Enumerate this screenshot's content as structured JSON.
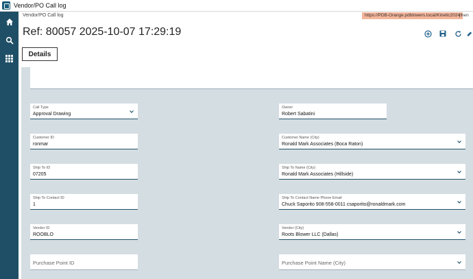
{
  "window": {
    "title": "Vendor/PO Call log"
  },
  "rail": {
    "items": [
      {
        "icon": "home-icon"
      },
      {
        "icon": "search-icon"
      },
      {
        "icon": "apps-grid-icon"
      }
    ]
  },
  "header": {
    "breadcrumb": "Vendor/PO Call log",
    "url": "https://PDB-Orange.pdblowers.local/Kinetic2024",
    "user": "jlhen",
    "ref_title": "Ref: 80057 2025-10-07 17:29:19",
    "toolbar": [
      {
        "icon": "add-circle-icon"
      },
      {
        "icon": "save-icon"
      },
      {
        "icon": "refresh-icon"
      },
      {
        "icon": "edit-pen-icon"
      }
    ],
    "tab_details": "Details"
  },
  "form": {
    "call_type": {
      "label": "Call Type",
      "value": "Approval Drawing"
    },
    "owner": {
      "label": "Owner",
      "value": "Robert Sabatini"
    },
    "customer_id": {
      "label": "Customer ID",
      "value": "ronmar"
    },
    "customer_name": {
      "label": "Customer Name (City)",
      "value": "Ronald Mark Associates (Boca Raton)"
    },
    "ship_to_id": {
      "label": "Ship To ID",
      "value": "07205"
    },
    "ship_to_name": {
      "label": "Ship To Name (City)",
      "value": "Ronald Mark Associates (Hillside)"
    },
    "ship_to_contact_id": {
      "label": "Ship To Contact ID",
      "value": "1"
    },
    "ship_to_contact_info": {
      "label": "Ship To Contact Name Phone Email",
      "value": "Chuck Saporito 908-558-0011 csaporito@ronaldmark.com"
    },
    "vendor_id": {
      "label": "Vendor ID",
      "value": "ROOBLO"
    },
    "vendor_city": {
      "label": "Vendor (City)",
      "value": "Roots Blower LLC (Dallas)"
    },
    "purchase_point_id": {
      "placeholder": "Purchase Point ID"
    },
    "purchase_point_name": {
      "placeholder": "Purchase Point Name (City)"
    }
  }
}
